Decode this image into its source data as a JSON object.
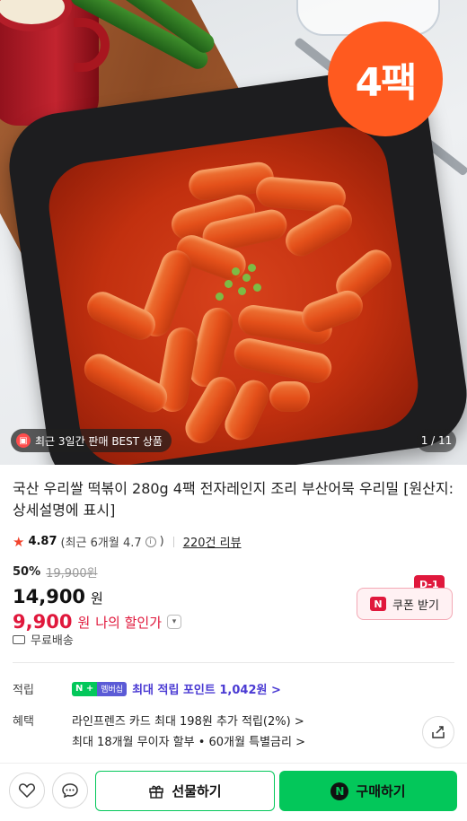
{
  "hero": {
    "pack_badge": "4팩",
    "best_badge": "최근 3일간 판매 BEST 상품",
    "counter": "1 / 11"
  },
  "product": {
    "title": "국산 우리쌀 떡볶이 280g 4팩 전자레인지 조리 부산어묵 우리밀 [원산지:상세설명에 표시]",
    "rating": "4.87",
    "recent_rating": "(최근 6개월 4.7",
    "reviews": "220건 리뷰",
    "discount_rate": "50%",
    "original_price": "19,900원",
    "price": "14,900",
    "price_unit": "원",
    "my_price": "9,900",
    "my_price_unit": "원",
    "my_price_label": "나의 할인가",
    "shipping": "무료배송"
  },
  "coupon": {
    "dday": "D-1",
    "label": "쿠폰 받기"
  },
  "points": {
    "label": "적립",
    "badge_n": "N +",
    "badge_member": "멤버십",
    "text": "최대 적립 포인트 1,042원 >"
  },
  "benefits": {
    "label": "혜택",
    "line1": "라인프렌즈 카드 최대 198원 추가 적립(2%) >",
    "line2": "최대 18개월 무이자 할부 • 60개월 특별금리 >"
  },
  "bottom_bar": {
    "gift_label": "선물하기",
    "buy_label": "구매하기",
    "buy_logo": "N"
  },
  "colors": {
    "accent_green": "#03c75a",
    "discount_red": "#e0183c",
    "badge_orange": "#ff5a1f",
    "point_purple": "#4a3ad3"
  },
  "icons": [
    "heart-icon",
    "chat-icon",
    "gift-icon",
    "share-icon",
    "truck-icon",
    "star-icon",
    "chevron-down-icon",
    "info-icon"
  ]
}
